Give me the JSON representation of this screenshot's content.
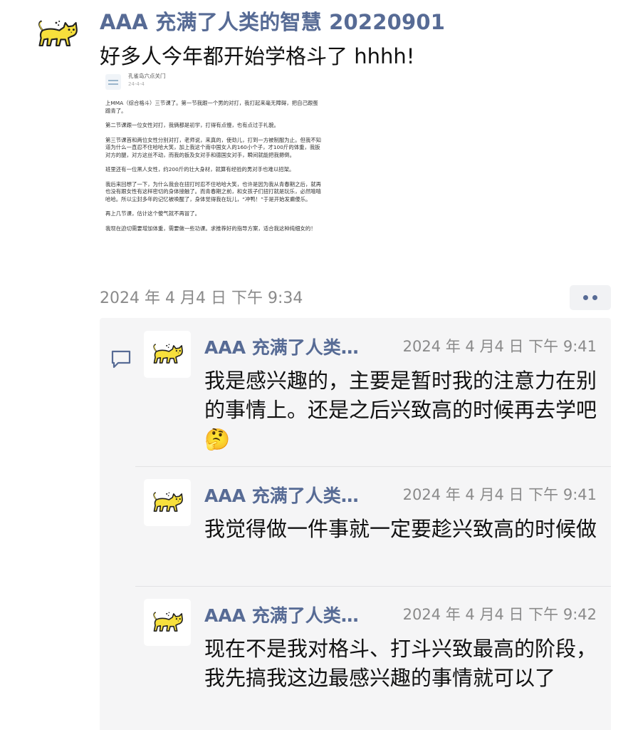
{
  "post": {
    "author": "AAA 充满了人类的智慧 20220901",
    "text": "好多人今年都开始学格斗了 hhhh!",
    "time": "2024 年 4 月4 日 下午 9:34",
    "avatar_icon": "yellow-cat-icon"
  },
  "image": {
    "source": "孔雀岛六点关门",
    "date": "24-4-4",
    "paragraphs": [
      "上MMA（综合格斗）三节课了。第一节我跟一个男的对打，我打起来毫无障碍，把自己跟蛋蹭青了。",
      "第二节课跟一位女性对打，我俩都是初学，打得有点慢，也有点过于礼貌。",
      "第三节课首和两位女性分别对打，老师说，来真的，使劲儿，打到一方被制服为止。但我不知道为什么一直忍不住哈哈大笑，加上我这个南中国女人的160小个子，才100斤的体重，我扳对方的腿，对方这丝不动，而我的扳及女对手和德国女对手，瞬间就能把我摁倒。",
      "班里还有一位黑人女性，约200斤的壮大身材，就算有经验的男对手也难以招架。",
      "我后来回想了一下，为什么我会在扭打时忍不住哈哈大笑，也许是因为我从青春期之后，就再也没有跟女性有这样密切的身体接触了。而青春期之前，和女孩子们扭打就是玩乐，必然嘻嘻哈哈。所以尘封多年的记忆被唤醒了，身体觉得我在玩儿，“冲鸭！”于是开始发癫傻乐。",
      "再上几节课，估计这个傻气就不再冒了。",
      "我现在迫切需要增加体重，需要做一些功课。求推荐好的指导方案，适合我这种纯细女的！"
    ]
  },
  "comments": [
    {
      "author": "AAA 充满了人类…",
      "time": "2024 年 4 月4 日 下午 9:41",
      "text": "我是感兴趣的，主要是暂时我的注意力在别的事情上。还是之后兴致高的时候再去学吧🤔"
    },
    {
      "author": "AAA 充满了人类…",
      "time": "2024 年 4 月4 日 下午 9:41",
      "text": "我觉得做一件事就一定要趁兴致高的时候做"
    },
    {
      "author": "AAA 充满了人类…",
      "time": "2024 年 4 月4 日 下午 9:42",
      "text": "现在不是我对格斗、打斗兴致最高的阶段，我先搞我这边最感兴趣的事情就可以了"
    }
  ],
  "icons": {
    "comment": "comment-bubble-icon",
    "more": "more-dots-icon"
  },
  "colors": {
    "name_blue": "#576b95",
    "comment_bg": "#f5f5f6",
    "time_gray": "#8a8a8a",
    "cat_yellow": "#f7e03c"
  }
}
